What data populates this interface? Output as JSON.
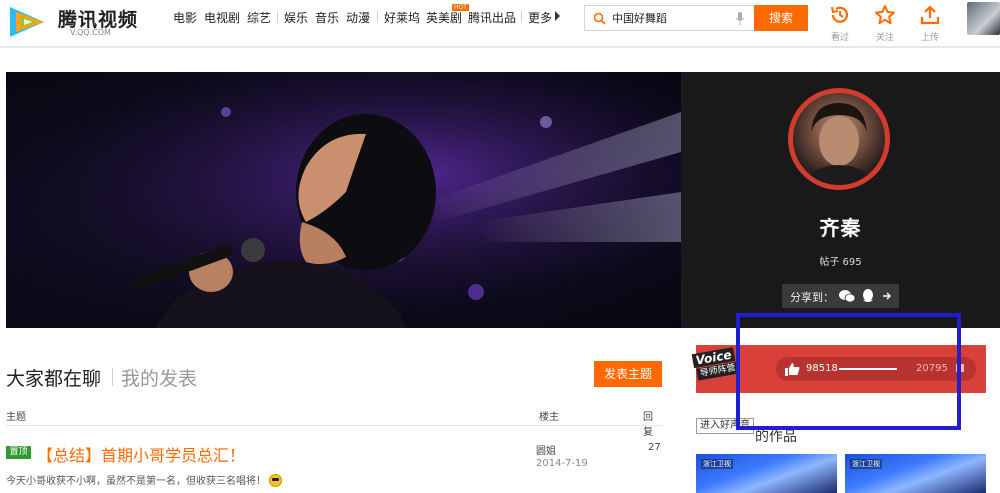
{
  "header": {
    "logo_title": "腾讯视频",
    "logo_sub": "V.QQ.COM",
    "nav": [
      {
        "label": "电影"
      },
      {
        "label": "电视剧"
      },
      {
        "label": "综艺"
      },
      {
        "label": "娱乐"
      },
      {
        "label": "音乐"
      },
      {
        "label": "动漫"
      },
      {
        "label": "好莱坞"
      },
      {
        "label": "英美剧",
        "badge": "HOT"
      },
      {
        "label": "腾讯出品"
      },
      {
        "label": "更多"
      }
    ],
    "search": {
      "value": "中国好舞蹈",
      "button": "搜索"
    },
    "tools": [
      {
        "label": "看过",
        "icon": "history-icon"
      },
      {
        "label": "关注",
        "icon": "star-icon"
      },
      {
        "label": "上传",
        "icon": "upload-icon"
      }
    ]
  },
  "profile": {
    "name": "齐秦",
    "posts": "帖子 695",
    "share_label": "分享到："
  },
  "discussion": {
    "tab_active": "大家都在聊",
    "tab_other": "我的发表",
    "post_button": "发表主题",
    "columns": {
      "subject": "主题",
      "author": "楼主",
      "replies": "回复"
    },
    "rows": [
      {
        "badge": "置顶",
        "title": "【总结】首期小哥学员总汇！",
        "excerpt": "今天小哥收获不小啊，虽然不是第一名，但收获三名唱将！",
        "author": "圆姐",
        "date": "2014-7-19",
        "replies": "27"
      }
    ]
  },
  "vote": {
    "show_logo_top": "Voice",
    "show_logo_bottom": "导师阵营",
    "likes": "98518",
    "dislikes": "20795",
    "progress": 0.83
  },
  "works": {
    "enter_button": "进入好声音",
    "title": "的作品"
  },
  "colors": {
    "accent": "#ff6a00",
    "pin": "#2f9a2f",
    "vote_red": "#d9403a",
    "highlight": "#1f1fd0"
  }
}
